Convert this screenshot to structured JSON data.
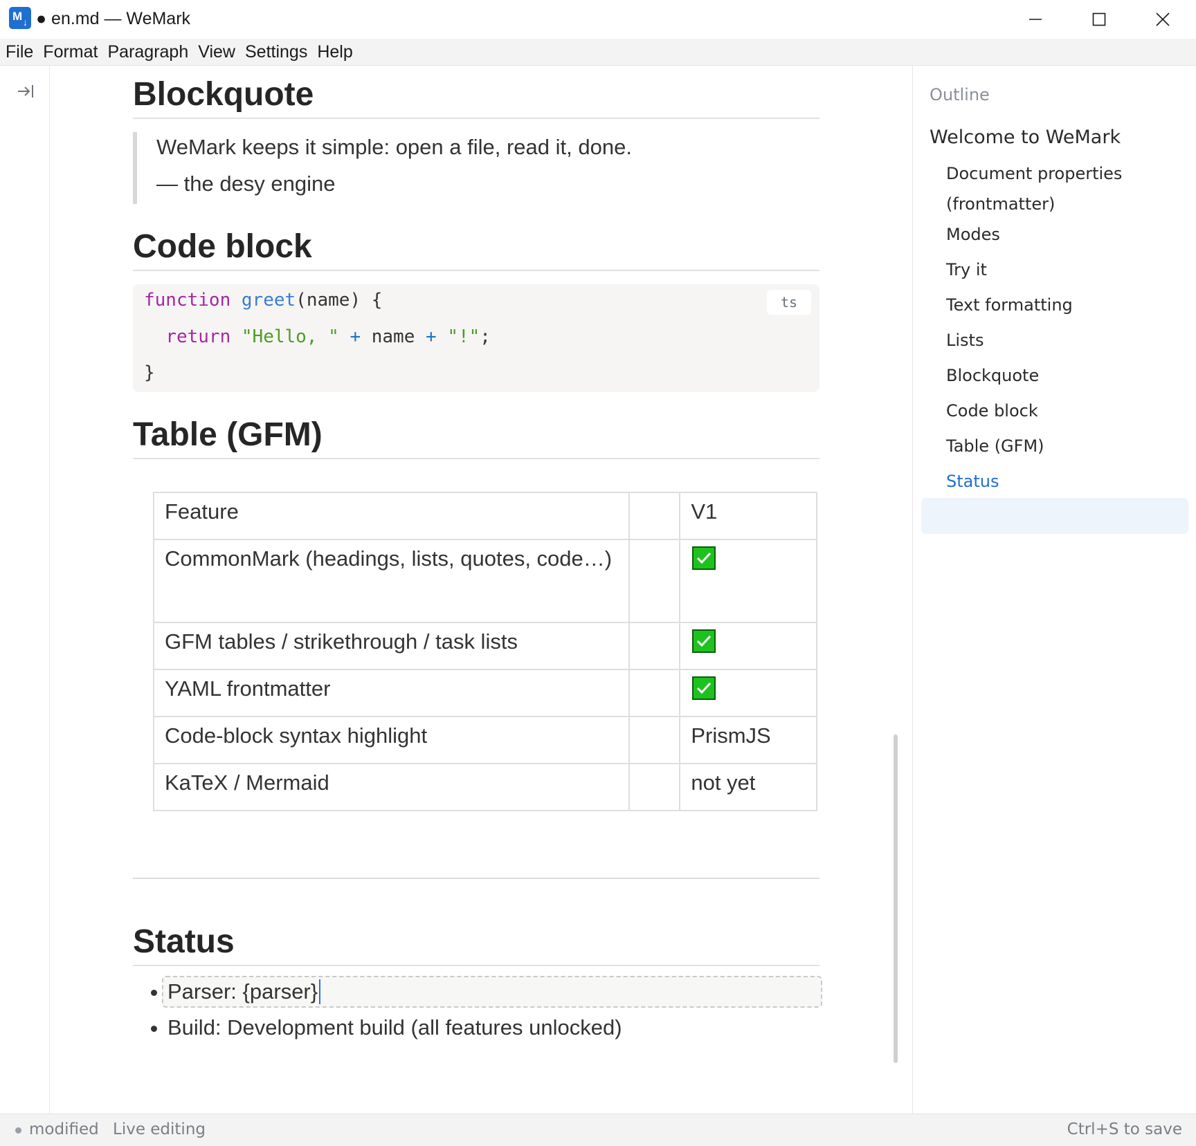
{
  "window": {
    "app_icon": "markdown-app-icon",
    "title": "● en.md — WeMark",
    "controls": [
      "minimize-icon",
      "maximize-icon",
      "close-icon"
    ]
  },
  "menu": [
    "File",
    "Format",
    "Paragraph",
    "View",
    "Settings",
    "Help"
  ],
  "left_rail": {
    "toggle_icon": "collapse-sidebar-icon"
  },
  "document": {
    "blockquote_heading": "Blockquote",
    "blockquote_lines": [
      "WeMark keeps it simple: open a file, read it, done.",
      "— the desy engine"
    ],
    "code_heading": "Code block",
    "code_language": "ts",
    "code_lines": [
      [
        {
          "t": "function",
          "c": "kw"
        },
        {
          "t": " ",
          "c": ""
        },
        {
          "t": "greet",
          "c": "fn"
        },
        {
          "t": "(name) {",
          "c": ""
        }
      ],
      [
        {
          "t": "  ",
          "c": ""
        },
        {
          "t": "return",
          "c": "kw"
        },
        {
          "t": " ",
          "c": ""
        },
        {
          "t": "\"Hello, \"",
          "c": "str"
        },
        {
          "t": " ",
          "c": ""
        },
        {
          "t": "+",
          "c": "op"
        },
        {
          "t": " name ",
          "c": ""
        },
        {
          "t": "+",
          "c": "op"
        },
        {
          "t": " ",
          "c": ""
        },
        {
          "t": "\"!\"",
          "c": "str"
        },
        {
          "t": ";",
          "c": ""
        }
      ],
      [
        {
          "t": "}",
          "c": ""
        }
      ]
    ],
    "table_heading": "Table (GFM)",
    "table": {
      "headers": [
        "Feature",
        "",
        "V1"
      ],
      "rows": [
        [
          "CommonMark (headings, lists, quotes, code…)",
          "",
          "✅"
        ],
        [
          "GFM tables / strikethrough / task lists",
          "",
          "✅"
        ],
        [
          "YAML frontmatter",
          "",
          "✅"
        ],
        [
          "Code-block syntax highlight",
          "",
          "PrismJS"
        ],
        [
          "KaTeX / Mermaid",
          "",
          "not yet"
        ]
      ]
    },
    "status_heading": "Status",
    "status_items": [
      "Parser: {parser}",
      "Build: Development build (all features unlocked)"
    ]
  },
  "outline": {
    "title": "Outline",
    "items": [
      {
        "label": "Welcome to WeMark",
        "level": 1
      },
      {
        "label": "Document properties (frontmatter)",
        "level": 2
      },
      {
        "label": "Modes",
        "level": 2
      },
      {
        "label": "Try it",
        "level": 2
      },
      {
        "label": "Text formatting",
        "level": 2
      },
      {
        "label": "Lists",
        "level": 2
      },
      {
        "label": "Blockquote",
        "level": 2
      },
      {
        "label": "Code block",
        "level": 2
      },
      {
        "label": "Table (GFM)",
        "level": 2
      },
      {
        "label": "Status",
        "level": 2,
        "active": true
      }
    ]
  },
  "statusbar": {
    "modified": "modified",
    "mode": "Live editing",
    "save_hint": "Ctrl+S to save"
  },
  "colors": {
    "accent": "#1f6fd1",
    "keyword": "#a626a4",
    "function": "#3a7bd5",
    "string": "#4e9a2a",
    "check": "#1ec21e"
  }
}
